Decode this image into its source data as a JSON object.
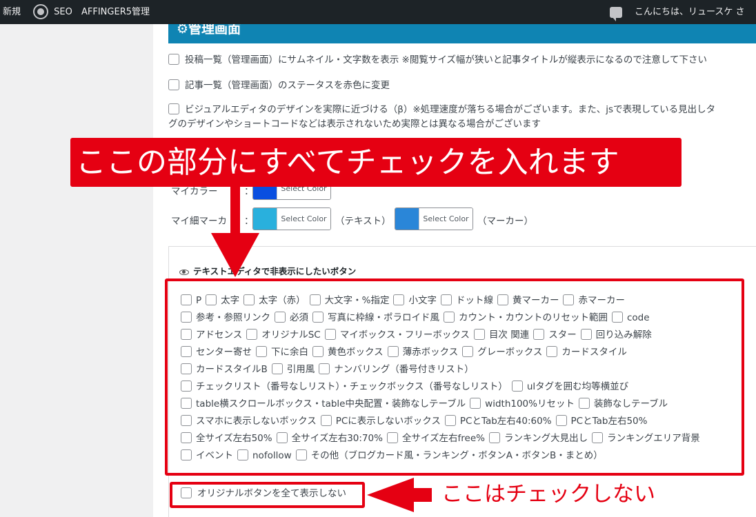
{
  "adminbar": {
    "new_label": "新規",
    "seo_label": "SEO",
    "affinger_label": "AFFINGER5管理",
    "greeting": "こんにちは、リュースケ さ"
  },
  "section": {
    "title": "管理画面"
  },
  "options": [
    "投稿一覧（管理画面）にサムネイル・文字数を表示 ※閲覧サイズ幅が狭いと記事タイトルが縦表示になるので注意して下さい",
    "記事一覧（管理画面）のステータスを赤色に変更",
    "ビジュアルエディタのデザインを実際に近づける（β）※処理速度が落ちる場合がございます。また、jsで表現している見出しタ",
    "グのデザインやショートコードなどは表示されないため実際とは異なる場合がございます"
  ],
  "colors": {
    "my_color_label": "マイカラー",
    "my_marker_label": "マイ細マーカ",
    "colon": "：",
    "select_color": "Select Color",
    "text_suffix": "（テキスト）",
    "marker_suffix": "（マーカー）",
    "my_color_hex": "#0a4fe0",
    "marker_text_hex": "#29b0dd",
    "marker_hex": "#2a86d8"
  },
  "editor": {
    "title": "テキストエディタで非表示にしたいボタン",
    "rows": [
      [
        "P",
        "太字",
        "太字（赤）",
        "大文字・%指定",
        "小文字",
        "ドット線",
        "黄マーカー",
        "赤マーカー"
      ],
      [
        "参考・参照リンク",
        "必須",
        "写真に枠線・ポラロイド風",
        "カウント・カウントのリセット範囲",
        "code"
      ],
      [
        "アドセンス",
        "オリジナルSC",
        "マイボックス・フリーボックス",
        "目次 関連",
        "スター",
        "回り込み解除"
      ],
      [
        "センター寄せ",
        "下に余白",
        "黄色ボックス",
        "薄赤ボックス",
        "グレーボックス",
        "カードスタイル"
      ],
      [
        "カードスタイルB",
        "引用風",
        "ナンバリング（番号付きリスト）"
      ],
      [
        "チェックリスト（番号なしリスト）・チェックボックス（番号なしリスト）",
        "ulタグを囲む均等横並び"
      ],
      [
        "table横スクロールボックス・table中央配置・装飾なしテーブル",
        "width100%リセット",
        "装飾なしテーブル"
      ],
      [
        "スマホに表示しないボックス",
        "PCに表示しないボックス",
        "PCとTab左右40:60%",
        "PCとTab左右50%"
      ],
      [
        "全サイズ左右50%",
        "全サイズ左右30:70%",
        "全サイズ左右free%",
        "ランキング大見出し",
        "ランキングエリア背景"
      ],
      [
        "イベント",
        "nofollow",
        "その他（ブログカード風・ランキング・ボタンA・ボタンB・まとめ）"
      ]
    ],
    "hide_all_label": "オリジナルボタンを全て表示しない"
  },
  "annotations": {
    "callout_main": "ここの部分にすべてチェックを入れます",
    "callout_side": "ここはチェックしない",
    "accent": "#e50012"
  }
}
